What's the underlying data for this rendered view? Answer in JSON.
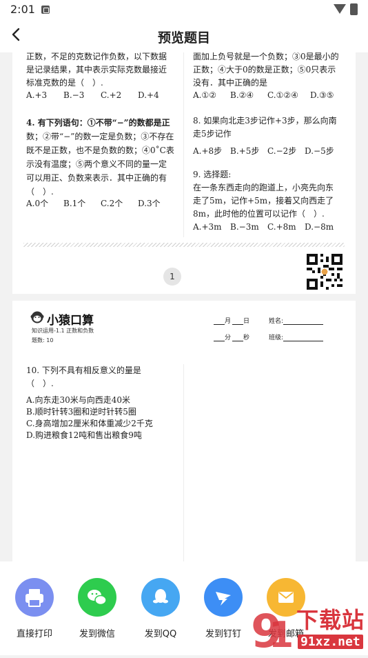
{
  "status": {
    "time": "2:01"
  },
  "header": {
    "title": "预览题目"
  },
  "page1": {
    "left": {
      "q3_tail": [
        "正数，不足的克数记作负数，以下数据",
        "是记录结果，其中表示实际克数最接近",
        "标准克数的是（　）."
      ],
      "q3_options": [
        "A.+3",
        "B.−3",
        "C.+2",
        "D.+4"
      ],
      "q4_lines": [
        "4. 有下列语句：①不带“−”的数都是正",
        "数；②带“−”的数一定是负数；③不存在",
        "既不是正数，也不是负数的数；④0˚C表",
        "示没有温度；⑤两个意义不同的量一定",
        "可以用正、负数来表示．其中正确的有",
        "（　）."
      ],
      "q4_options": [
        "A.0个",
        "B.1个",
        "C.2个",
        "D.3个"
      ]
    },
    "right": {
      "q7_tail": [
        "面加上负号就是一个负数；③0是最小的",
        "正数；④大于0的数是正数；⑤0只表示",
        "没有．其中正确的是"
      ],
      "q7_options": [
        "A.①②",
        "B.②④",
        "C.①②④",
        "D.③⑤"
      ],
      "q8_lines": [
        "8. 如果向北走3步记作+3步，那么向南",
        "走5步记作"
      ],
      "q8_options": [
        "A.+8步",
        "B.+5步",
        "C.−2步",
        "D.−5步"
      ],
      "q9_lines": [
        "9. 选择题:",
        "在一条东西走向的跑道上，小亮先向东",
        "走了5m，记作+5m，接着又向西走了",
        "8m，此时他的位置可以记作（　）."
      ],
      "q9_options": [
        "A.+3m",
        "B.−3m",
        "C.+8m",
        "D.−8m"
      ]
    },
    "page_number": "1"
  },
  "page2": {
    "logo": "小猿口算",
    "subtitle": "知识运用-1.1 正数和负数",
    "question_count": "题数: 10",
    "fields": {
      "month": "月",
      "day": "日",
      "name": "姓名:",
      "minute": "分",
      "second": "秒",
      "class": "班级:"
    },
    "q10_lines": [
      "10. 下列不具有相反意义的量是",
      "（　）."
    ],
    "q10_options": [
      "A.向东走30米与向西走40米",
      "B.顺时针转3圈和逆时针转5圈",
      "C.身高增加2厘米和体重减少2千克",
      "D.购进粮食12吨和售出粮食9吨"
    ]
  },
  "share": {
    "items": [
      {
        "label": "直接打印",
        "color": "#7b8ff0",
        "icon": "printer-icon"
      },
      {
        "label": "发到微信",
        "color": "#2ecc4e",
        "icon": "wechat-icon"
      },
      {
        "label": "发到QQ",
        "color": "#46a7f2",
        "icon": "qq-icon"
      },
      {
        "label": "发到钉钉",
        "color": "#3d8ef5",
        "icon": "dingtalk-icon"
      },
      {
        "label": "发到邮箱",
        "color": "#f7b733",
        "icon": "mail-icon"
      }
    ]
  },
  "watermark": {
    "text1": "下载站",
    "text2": "91xz.net"
  }
}
